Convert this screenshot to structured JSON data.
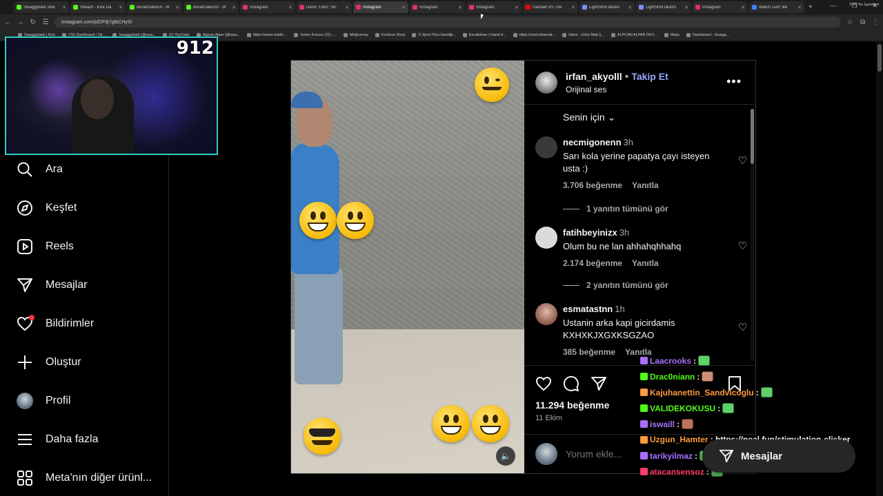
{
  "browser": {
    "tabs": [
      {
        "label": "Swaggybark Stre",
        "color": "#53fc18"
      },
      {
        "label": "Stream - Kick Da",
        "color": "#53fc18"
      },
      {
        "label": "BurakSakinOl - W",
        "color": "#53fc18"
      },
      {
        "label": "BurakSakinOl - W",
        "color": "#53fc18"
      },
      {
        "label": "Instagram",
        "color": "#e1306c"
      },
      {
        "label": "Deniz Yıldız: S6:",
        "color": "#e1306c"
      },
      {
        "label": "Instagram",
        "color": "#e1306c"
      },
      {
        "label": "Instagram",
        "color": "#e1306c"
      },
      {
        "label": "Instagram",
        "color": "#e1306c"
      },
      {
        "label": "Gandalf VS The",
        "color": "#ff0000"
      },
      {
        "label": "LightShot tarafın",
        "color": "#7b8cff"
      },
      {
        "label": "LightShot tarafın",
        "color": "#7b8cff"
      },
      {
        "label": "Instagram",
        "color": "#e1306c"
      },
      {
        "label": "Watch Livin' life",
        "color": "#3b82f6"
      }
    ],
    "url": "instagram.com/p/DF9j7gtbCHyS/",
    "bookmarks": [
      "Swaggybark | Kick",
      "(79) Dashboard / Str...",
      "Swaggybark (@swa...",
      "(2) YouTube",
      "Alpcan Alpar (@swa...",
      "https://www.reddit....",
      "Gelen Kutusu (31) -...",
      "Midjourney",
      "Konfuse Shop",
      "S Sport Plus-İstediği...",
      "Excalidraw | Hand-d...",
      "https://next.inkarnat...",
      "Inbox - Zoho Mail (j...",
      "ALPCAN ALPAR DEV...",
      "Maps",
      "Dashboard - Swagg..."
    ],
    "bookmarks_right": "Tüm Yer İşaretleri"
  },
  "overlay": {
    "counter": "912"
  },
  "sidebar": {
    "items": [
      {
        "label": "Ara",
        "icon": "search-icon"
      },
      {
        "label": "Keşfet",
        "icon": "compass-icon"
      },
      {
        "label": "Reels",
        "icon": "reels-icon"
      },
      {
        "label": "Mesajlar",
        "icon": "messages-icon"
      },
      {
        "label": "Bildirimler",
        "icon": "heart-icon"
      },
      {
        "label": "Oluştur",
        "icon": "plus-icon"
      },
      {
        "label": "Profil",
        "icon": "avatar"
      },
      {
        "label": "Daha fazla",
        "icon": "menu-icon"
      },
      {
        "label": "Meta'nın diğer ürünl...",
        "icon": "grid-icon"
      }
    ]
  },
  "post": {
    "username": "irfan_akyolll",
    "follow_label": "Takip Et",
    "audio": "Orijinal ses",
    "sort_label": "Senin için",
    "comments": [
      {
        "user": "necmigonenn",
        "time": "3h",
        "text": "Sarı kola yerine papatya çayı isteyen usta :)",
        "likes": "3.706 beğenme",
        "reply": "Yanıtla",
        "avatar_color": "#3a3a3a"
      },
      {
        "user": "fatihbeyinizx",
        "time": "3h",
        "text": "Olum bu ne lan ahhahqhhahq",
        "likes": "2.174 beğenme",
        "reply": "Yanıtla",
        "avatar_color": "#dbdbdb"
      },
      {
        "user": "esmatastnn",
        "time": "1h",
        "text": "Ustanin arka kapi gicirdamis KXHXKJXGXKSGZAO",
        "likes": "385 beğenme",
        "reply": "Yanıtla",
        "avatar_color": "#8a5a4a"
      }
    ],
    "view_replies": [
      "1 yanıtın tümünü gör",
      "2 yanıtın tümünü gör"
    ],
    "likes_total": "11.294 beğenme",
    "date": "11 Ekim",
    "comment_placeholder": "Yorum ekle..."
  },
  "chat": [
    {
      "user": "Laacrooks",
      "color": "#a970ff",
      "text": ":",
      "emote": "green"
    },
    {
      "user": "Drac0niann",
      "color": "#53fc18",
      "text": ":",
      "emote": "ppl"
    },
    {
      "user": "Kajuhanettin_Sandvicoglu",
      "color": "#ff9a3c",
      "text": ":",
      "emote": "green"
    },
    {
      "user": "VALIDEKOKUSU",
      "color": "#53fc18",
      "text": ":",
      "emote": "green"
    },
    {
      "user": "iswaill",
      "color": "#a970ff",
      "text": ":",
      "emote": "red"
    },
    {
      "user": "Uzgun_Hamter",
      "color": "#ff9a3c",
      "text": ": https://neal.fun/stimulation-clicker",
      "emote": ""
    },
    {
      "user": "tarikyilmaz",
      "color": "#a970ff",
      "text": ":",
      "emote": "green"
    },
    {
      "user": "atacansensoz",
      "color": "#ff3b6b",
      "text": ":",
      "emote": "green"
    }
  ],
  "dm_float_label": "Mesajlar"
}
